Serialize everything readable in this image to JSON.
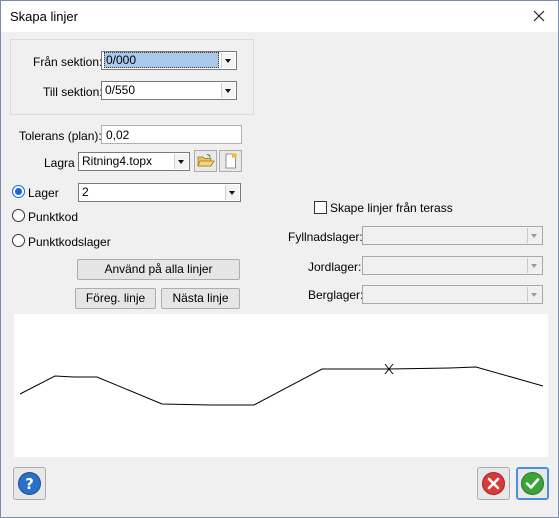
{
  "window": {
    "title": "Skapa linjer"
  },
  "range": {
    "from_label": "Från sektion:",
    "from_value": "0/000",
    "to_label": "Till sektion:",
    "to_value": "0/550"
  },
  "tolerance": {
    "label": "Tolerans (plan):",
    "value": "0,02"
  },
  "save": {
    "label": "Lagra i:",
    "value": "Ritning4.topx"
  },
  "source": {
    "layer_label": "Lager",
    "layer_value": "2",
    "point_code_label": "Punktkod",
    "point_code_layer_label": "Punktkodslager",
    "selected": "Lager"
  },
  "buttons": {
    "apply_all": "Använd på alla linjer",
    "prev_line": "Föreg. linje",
    "next_line": "Nästa linje"
  },
  "terrace": {
    "checkbox_label": "Skape linjer från terass",
    "checked": false,
    "fill_label": "Fyllnadslager:",
    "soil_label": "Jordlager:",
    "rock_label": "Berglager:"
  },
  "icons": {
    "close": "close-icon",
    "folder": "folder-open-icon",
    "new_file": "new-file-icon",
    "help": "help-icon",
    "cancel": "cancel-icon",
    "ok": "ok-check-icon"
  },
  "colors": {
    "help_blue": "#2a6fc9",
    "cancel_red": "#d93a3a",
    "ok_green": "#3aa43a",
    "radio_accent": "#1266d6"
  }
}
